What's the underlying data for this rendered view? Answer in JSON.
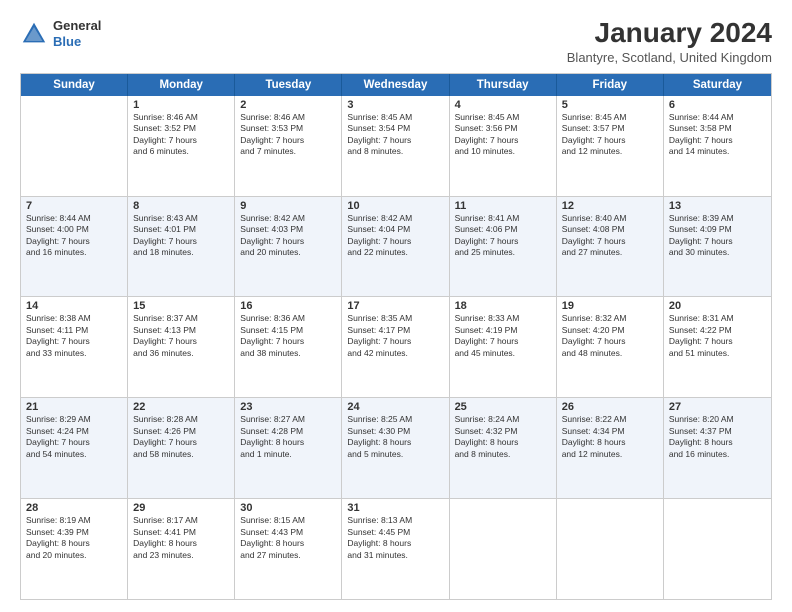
{
  "header": {
    "logo_general": "General",
    "logo_blue": "Blue",
    "month_title": "January 2024",
    "location": "Blantyre, Scotland, United Kingdom"
  },
  "days": [
    "Sunday",
    "Monday",
    "Tuesday",
    "Wednesday",
    "Thursday",
    "Friday",
    "Saturday"
  ],
  "weeks": [
    [
      {
        "date": "",
        "info": ""
      },
      {
        "date": "1",
        "info": "Sunrise: 8:46 AM\nSunset: 3:52 PM\nDaylight: 7 hours\nand 6 minutes."
      },
      {
        "date": "2",
        "info": "Sunrise: 8:46 AM\nSunset: 3:53 PM\nDaylight: 7 hours\nand 7 minutes."
      },
      {
        "date": "3",
        "info": "Sunrise: 8:45 AM\nSunset: 3:54 PM\nDaylight: 7 hours\nand 8 minutes."
      },
      {
        "date": "4",
        "info": "Sunrise: 8:45 AM\nSunset: 3:56 PM\nDaylight: 7 hours\nand 10 minutes."
      },
      {
        "date": "5",
        "info": "Sunrise: 8:45 AM\nSunset: 3:57 PM\nDaylight: 7 hours\nand 12 minutes."
      },
      {
        "date": "6",
        "info": "Sunrise: 8:44 AM\nSunset: 3:58 PM\nDaylight: 7 hours\nand 14 minutes."
      }
    ],
    [
      {
        "date": "7",
        "info": "Sunrise: 8:44 AM\nSunset: 4:00 PM\nDaylight: 7 hours\nand 16 minutes."
      },
      {
        "date": "8",
        "info": "Sunrise: 8:43 AM\nSunset: 4:01 PM\nDaylight: 7 hours\nand 18 minutes."
      },
      {
        "date": "9",
        "info": "Sunrise: 8:42 AM\nSunset: 4:03 PM\nDaylight: 7 hours\nand 20 minutes."
      },
      {
        "date": "10",
        "info": "Sunrise: 8:42 AM\nSunset: 4:04 PM\nDaylight: 7 hours\nand 22 minutes."
      },
      {
        "date": "11",
        "info": "Sunrise: 8:41 AM\nSunset: 4:06 PM\nDaylight: 7 hours\nand 25 minutes."
      },
      {
        "date": "12",
        "info": "Sunrise: 8:40 AM\nSunset: 4:08 PM\nDaylight: 7 hours\nand 27 minutes."
      },
      {
        "date": "13",
        "info": "Sunrise: 8:39 AM\nSunset: 4:09 PM\nDaylight: 7 hours\nand 30 minutes."
      }
    ],
    [
      {
        "date": "14",
        "info": "Sunrise: 8:38 AM\nSunset: 4:11 PM\nDaylight: 7 hours\nand 33 minutes."
      },
      {
        "date": "15",
        "info": "Sunrise: 8:37 AM\nSunset: 4:13 PM\nDaylight: 7 hours\nand 36 minutes."
      },
      {
        "date": "16",
        "info": "Sunrise: 8:36 AM\nSunset: 4:15 PM\nDaylight: 7 hours\nand 38 minutes."
      },
      {
        "date": "17",
        "info": "Sunrise: 8:35 AM\nSunset: 4:17 PM\nDaylight: 7 hours\nand 42 minutes."
      },
      {
        "date": "18",
        "info": "Sunrise: 8:33 AM\nSunset: 4:19 PM\nDaylight: 7 hours\nand 45 minutes."
      },
      {
        "date": "19",
        "info": "Sunrise: 8:32 AM\nSunset: 4:20 PM\nDaylight: 7 hours\nand 48 minutes."
      },
      {
        "date": "20",
        "info": "Sunrise: 8:31 AM\nSunset: 4:22 PM\nDaylight: 7 hours\nand 51 minutes."
      }
    ],
    [
      {
        "date": "21",
        "info": "Sunrise: 8:29 AM\nSunset: 4:24 PM\nDaylight: 7 hours\nand 54 minutes."
      },
      {
        "date": "22",
        "info": "Sunrise: 8:28 AM\nSunset: 4:26 PM\nDaylight: 7 hours\nand 58 minutes."
      },
      {
        "date": "23",
        "info": "Sunrise: 8:27 AM\nSunset: 4:28 PM\nDaylight: 8 hours\nand 1 minute."
      },
      {
        "date": "24",
        "info": "Sunrise: 8:25 AM\nSunset: 4:30 PM\nDaylight: 8 hours\nand 5 minutes."
      },
      {
        "date": "25",
        "info": "Sunrise: 8:24 AM\nSunset: 4:32 PM\nDaylight: 8 hours\nand 8 minutes."
      },
      {
        "date": "26",
        "info": "Sunrise: 8:22 AM\nSunset: 4:34 PM\nDaylight: 8 hours\nand 12 minutes."
      },
      {
        "date": "27",
        "info": "Sunrise: 8:20 AM\nSunset: 4:37 PM\nDaylight: 8 hours\nand 16 minutes."
      }
    ],
    [
      {
        "date": "28",
        "info": "Sunrise: 8:19 AM\nSunset: 4:39 PM\nDaylight: 8 hours\nand 20 minutes."
      },
      {
        "date": "29",
        "info": "Sunrise: 8:17 AM\nSunset: 4:41 PM\nDaylight: 8 hours\nand 23 minutes."
      },
      {
        "date": "30",
        "info": "Sunrise: 8:15 AM\nSunset: 4:43 PM\nDaylight: 8 hours\nand 27 minutes."
      },
      {
        "date": "31",
        "info": "Sunrise: 8:13 AM\nSunset: 4:45 PM\nDaylight: 8 hours\nand 31 minutes."
      },
      {
        "date": "",
        "info": ""
      },
      {
        "date": "",
        "info": ""
      },
      {
        "date": "",
        "info": ""
      }
    ]
  ]
}
